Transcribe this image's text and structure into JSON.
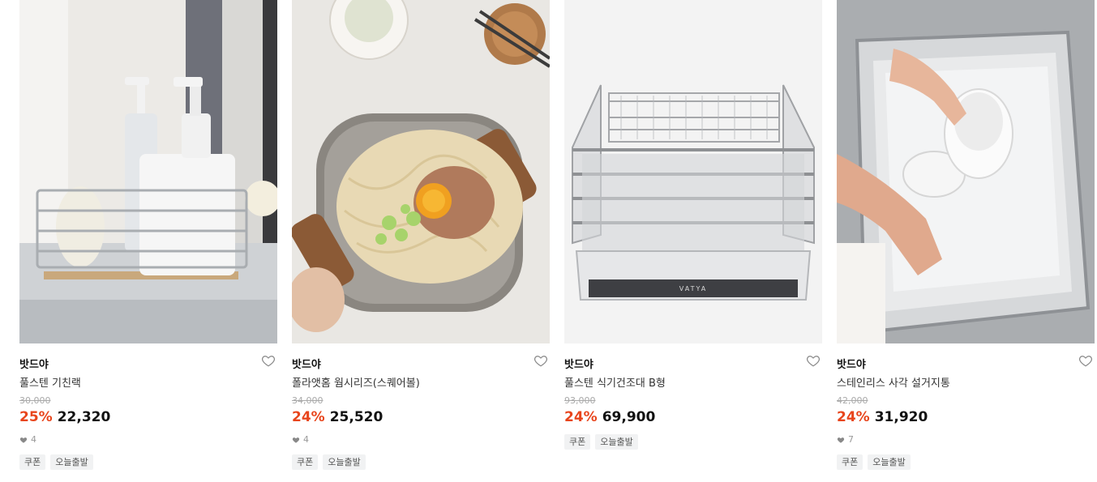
{
  "products": [
    {
      "brand": "밧드야",
      "title": "풀스텐 기친랙",
      "original_price": "30,000",
      "discount": "25%",
      "price": "22,320",
      "likes": "4",
      "tags": [
        "쿠폰",
        "오늘출발"
      ]
    },
    {
      "brand": "밧드야",
      "title": "폴라앳홈 웜시리즈(스퀘어볼)",
      "original_price": "34,000",
      "discount": "24%",
      "price": "25,520",
      "likes": "4",
      "tags": [
        "쿠폰",
        "오늘출발"
      ]
    },
    {
      "brand": "밧드야",
      "title": "풀스텐 식기건조대 B형",
      "original_price": "93,000",
      "discount": "24%",
      "price": "69,900",
      "tags": [
        "쿠폰",
        "오늘출발"
      ]
    },
    {
      "brand": "밧드야",
      "title": "스테인리스 사각 설거지통",
      "original_price": "42,000",
      "discount": "24%",
      "price": "31,920",
      "likes": "7",
      "tags": [
        "쿠폰",
        "오늘출발"
      ]
    }
  ],
  "image_labels": {
    "rack_brand": "VATYA"
  },
  "colors": {
    "discount": "#e8451c",
    "tag_bg": "#f1f2f3",
    "strike": "#aaaaaa"
  },
  "icons": {
    "wishlist": "heart-outline-icon",
    "likes": "heart-filled-icon"
  }
}
